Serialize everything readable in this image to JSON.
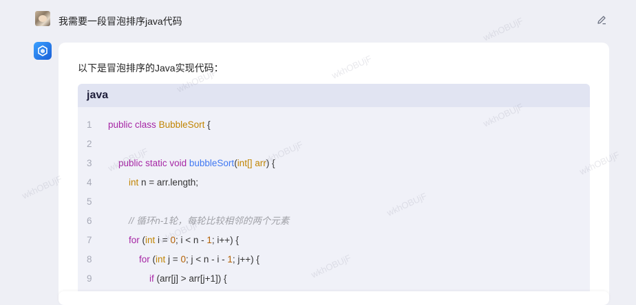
{
  "user": {
    "message": "我需要一段冒泡排序java代码"
  },
  "reply": {
    "intro": "以下是冒泡排序的Java实现代码：",
    "code": {
      "language": "java",
      "lines": [
        {
          "num": "1",
          "tokens": [
            {
              "t": "kw",
              "v": "public"
            },
            {
              "t": "plain",
              "v": " "
            },
            {
              "t": "kw",
              "v": "class"
            },
            {
              "t": "plain",
              "v": " "
            },
            {
              "t": "cls",
              "v": "BubbleSort"
            },
            {
              "t": "plain",
              "v": " {"
            }
          ]
        },
        {
          "num": "2",
          "tokens": []
        },
        {
          "num": "3",
          "tokens": [
            {
              "t": "plain",
              "v": "    "
            },
            {
              "t": "kw",
              "v": "public"
            },
            {
              "t": "plain",
              "v": " "
            },
            {
              "t": "kw",
              "v": "static"
            },
            {
              "t": "plain",
              "v": " "
            },
            {
              "t": "kw",
              "v": "void"
            },
            {
              "t": "plain",
              "v": " "
            },
            {
              "t": "fn",
              "v": "bubbleSort"
            },
            {
              "t": "plain",
              "v": "("
            },
            {
              "t": "cls",
              "v": "int[] arr"
            },
            {
              "t": "plain",
              "v": ") {"
            }
          ]
        },
        {
          "num": "4",
          "tokens": [
            {
              "t": "plain",
              "v": "        "
            },
            {
              "t": "cls",
              "v": "int"
            },
            {
              "t": "plain",
              "v": " n = arr.length;"
            }
          ]
        },
        {
          "num": "5",
          "tokens": []
        },
        {
          "num": "6",
          "tokens": [
            {
              "t": "plain",
              "v": "        "
            },
            {
              "t": "cmt",
              "v": "// 循环n-1轮，每轮比较相邻的两个元素"
            }
          ]
        },
        {
          "num": "7",
          "tokens": [
            {
              "t": "plain",
              "v": "        "
            },
            {
              "t": "kw",
              "v": "for"
            },
            {
              "t": "plain",
              "v": " ("
            },
            {
              "t": "cls",
              "v": "int"
            },
            {
              "t": "plain",
              "v": " i = "
            },
            {
              "t": "num",
              "v": "0"
            },
            {
              "t": "plain",
              "v": "; i < n - "
            },
            {
              "t": "num",
              "v": "1"
            },
            {
              "t": "plain",
              "v": "; i++) {"
            }
          ]
        },
        {
          "num": "8",
          "tokens": [
            {
              "t": "plain",
              "v": "            "
            },
            {
              "t": "kw",
              "v": "for"
            },
            {
              "t": "plain",
              "v": " ("
            },
            {
              "t": "cls",
              "v": "int"
            },
            {
              "t": "plain",
              "v": " j = "
            },
            {
              "t": "num",
              "v": "0"
            },
            {
              "t": "plain",
              "v": "; j < n - i - "
            },
            {
              "t": "num",
              "v": "1"
            },
            {
              "t": "plain",
              "v": "; j++) {"
            }
          ]
        },
        {
          "num": "9",
          "tokens": [
            {
              "t": "plain",
              "v": "                "
            },
            {
              "t": "kw",
              "v": "if"
            },
            {
              "t": "plain",
              "v": " (arr[j] > arr[j+1]) {"
            }
          ]
        }
      ]
    }
  },
  "watermark": "wkhOBUjF",
  "icons": {
    "edit": "pencil-edit-icon",
    "bot": "assistant-cube-icon"
  }
}
